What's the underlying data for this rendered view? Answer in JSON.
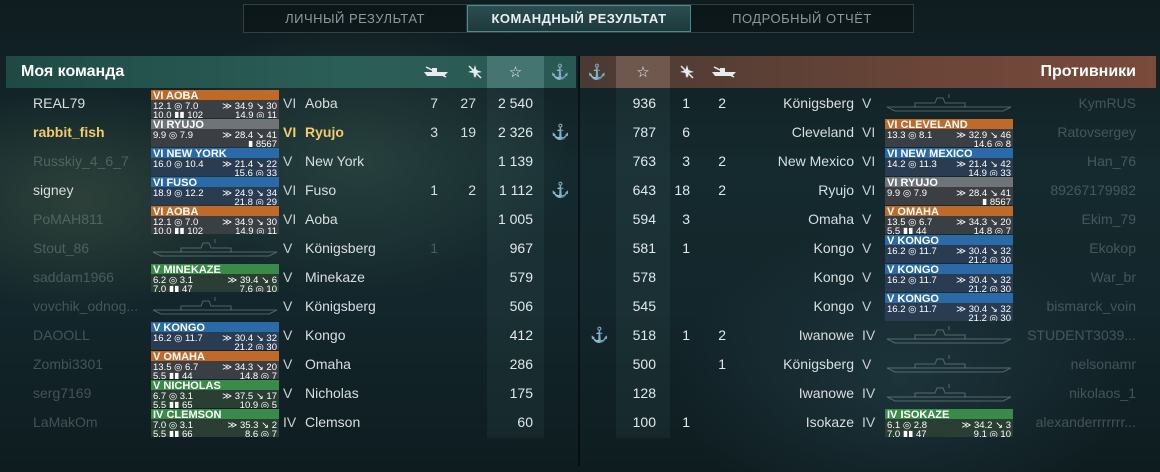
{
  "tabs": [
    {
      "label": "ЛИЧНЫЙ РЕЗУЛЬТАТ",
      "active": false
    },
    {
      "label": "КОМАНДНЫЙ РЕЗУЛЬТАТ",
      "active": true
    },
    {
      "label": "ПОДРОБНЫЙ ОТЧЁТ",
      "active": false
    }
  ],
  "my_team": {
    "title": "Моя команда",
    "columns": [
      "ship-kills-icon",
      "plane-kills-icon",
      "star-icon",
      "anchor-icon"
    ],
    "rows": [
      {
        "player": "REAL79",
        "card": {
          "title": "VI AOBA",
          "color": "orange",
          "l1a": "12.1 ◎ 7.0",
          "l1b": "≫ 34.9 ↘ 30",
          "l2a": "10.0 ▮▮ 102",
          "l2b": "14.9 ◎ 11"
        },
        "tier": "VI",
        "ship": "Aoba",
        "kills": "7",
        "planes": "27",
        "score": "2 540",
        "anchor": "",
        "dim": false,
        "me": false
      },
      {
        "player": "rabbit_fish",
        "card": {
          "title": "VI RYUJO",
          "color": "gray",
          "l1a": "9.9 ◎ 7.9",
          "l1b": "≫ 28.4 ↘ 41",
          "l2a": "",
          "l2b": "▮ 8567"
        },
        "tier": "VI",
        "ship": "Ryujo",
        "kills": "3",
        "planes": "19",
        "score": "2 326",
        "anchor": "⚓",
        "dim": false,
        "me": true
      },
      {
        "player": "Russkiy_4_6_7",
        "card": {
          "title": "VI NEW YORK",
          "color": "blue",
          "l1a": "16.0 ◎ 10.4",
          "l1b": "≫ 21.4 ↘ 22",
          "l2a": "",
          "l2b": "15.6 ◎ 33"
        },
        "tier": "V",
        "ship": "New York",
        "kills": "",
        "planes": "",
        "score": "1 139",
        "anchor": "",
        "dim": true,
        "me": false
      },
      {
        "player": "signey",
        "card": {
          "title": "VI FUSO",
          "color": "blue",
          "l1a": "18.9 ◎ 12.2",
          "l1b": "≫ 24.9 ↘ 34",
          "l2a": "",
          "l2b": "21.8 ◎ 29"
        },
        "tier": "VI",
        "ship": "Fuso",
        "kills": "1",
        "planes": "2",
        "score": "1 112",
        "anchor": "⚓",
        "dim": false,
        "me": false
      },
      {
        "player": "PoMAH811",
        "card": {
          "title": "VI AOBA",
          "color": "orange",
          "l1a": "12.1 ◎ 7.0",
          "l1b": "≫ 34.9 ↘ 30",
          "l2a": "10.0 ▮▮ 102",
          "l2b": "14.9 ◎ 11"
        },
        "tier": "VI",
        "ship": "Aoba",
        "kills": "",
        "planes": "",
        "score": "1 005",
        "anchor": "",
        "dim": true,
        "me": false
      },
      {
        "player": "Stout_86",
        "card": null,
        "tier": "V",
        "ship": "Königsberg",
        "kills": "1",
        "planes": "",
        "score": "967",
        "anchor": "",
        "dim": true,
        "me": false
      },
      {
        "player": "saddam1966",
        "card": {
          "title": "V MINEKAZE",
          "color": "green",
          "l1a": "6.2 ◎ 3.1",
          "l1b": "≫ 39.4 ↘ 6",
          "l2a": "7.0 ▮▮ 47",
          "l2b": "7.6 ◎ 10"
        },
        "tier": "V",
        "ship": "Minekaze",
        "kills": "",
        "planes": "",
        "score": "579",
        "anchor": "",
        "dim": true,
        "me": false
      },
      {
        "player": "vovchik_odnog...",
        "card": null,
        "tier": "V",
        "ship": "Königsberg",
        "kills": "",
        "planes": "",
        "score": "506",
        "anchor": "",
        "dim": true,
        "me": false
      },
      {
        "player": "DAOOLL",
        "card": {
          "title": "V KONGO",
          "color": "blue",
          "l1a": "16.2 ◎ 11.7",
          "l1b": "≫ 30.4 ↘ 32",
          "l2a": "",
          "l2b": "21.2 ◎ 30"
        },
        "tier": "V",
        "ship": "Kongo",
        "kills": "",
        "planes": "",
        "score": "412",
        "anchor": "",
        "dim": true,
        "me": false
      },
      {
        "player": "Zombi3301",
        "card": {
          "title": "V OMAHA",
          "color": "orange",
          "l1a": "13.5 ◎ 6.7",
          "l1b": "≫ 34.3 ↘ 20",
          "l2a": "5.5 ▮▮ 44",
          "l2b": "14.8 ◎ 7"
        },
        "tier": "V",
        "ship": "Omaha",
        "kills": "",
        "planes": "",
        "score": "286",
        "anchor": "",
        "dim": true,
        "me": false
      },
      {
        "player": "serg7169",
        "card": {
          "title": "V NICHOLAS",
          "color": "green",
          "l1a": "6.7 ◎ 3.1",
          "l1b": "≫ 37.5 ↘ 17",
          "l2a": "5.5 ▮▮ 65",
          "l2b": "10.9 ◎ 5"
        },
        "tier": "V",
        "ship": "Nicholas",
        "kills": "",
        "planes": "",
        "score": "175",
        "anchor": "",
        "dim": true,
        "me": false
      },
      {
        "player": "LaMakOm",
        "card": {
          "title": "IV CLEMSON",
          "color": "green",
          "l1a": "7.0 ◎ 3.1",
          "l1b": "≫ 35.3 ↘ 2",
          "l2a": "5.5 ▮▮ 66",
          "l2b": "8.6 ◎ 7"
        },
        "tier": "IV",
        "ship": "Clemson",
        "kills": "",
        "planes": "",
        "score": "60",
        "anchor": "",
        "dim": true,
        "me": false
      }
    ]
  },
  "enemy_team": {
    "title": "Противники",
    "columns": [
      "anchor-icon",
      "star-icon",
      "plane-kills-icon",
      "ship-kills-icon"
    ],
    "rows": [
      {
        "anchor": "",
        "score": "936",
        "planes": "1",
        "kills": "2",
        "ship": "Königsberg",
        "tier": "V",
        "card": null,
        "player": "KymRUS",
        "dim": true
      },
      {
        "anchor": "",
        "score": "787",
        "planes": "6",
        "kills": "",
        "ship": "Cleveland",
        "tier": "VI",
        "card": {
          "title": "VI CLEVELAND",
          "color": "orange",
          "l1a": "13.3 ◎ 8.1",
          "l1b": "≫ 32.9 ↘ 46",
          "l2a": "",
          "l2b": "14.6 ◎ 8"
        },
        "player": "Ratovsergey",
        "dim": true
      },
      {
        "anchor": "",
        "score": "763",
        "planes": "3",
        "kills": "2",
        "ship": "New Mexico",
        "tier": "VI",
        "card": {
          "title": "VI NEW MEXICO",
          "color": "blue",
          "l1a": "14.2 ◎ 11.3",
          "l1b": "≫ 21.4 ↘ 42",
          "l2a": "",
          "l2b": "14.9 ◎ 33"
        },
        "player": "Han_76",
        "dim": true
      },
      {
        "anchor": "",
        "score": "643",
        "planes": "18",
        "kills": "2",
        "ship": "Ryujo",
        "tier": "VI",
        "card": {
          "title": "VI RYUJO",
          "color": "gray",
          "l1a": "9.9 ◎ 7.9",
          "l1b": "≫ 28.4 ↘ 41",
          "l2a": "",
          "l2b": "▮ 8567"
        },
        "player": "89267179982",
        "dim": true
      },
      {
        "anchor": "",
        "score": "594",
        "planes": "3",
        "kills": "",
        "ship": "Omaha",
        "tier": "V",
        "card": {
          "title": "V OMAHA",
          "color": "orange",
          "l1a": "13.5 ◎ 6.7",
          "l1b": "≫ 34.3 ↘ 20",
          "l2a": "5.5 ▮▮ 44",
          "l2b": "14.8 ◎ 7"
        },
        "player": "Ekim_79",
        "dim": true
      },
      {
        "anchor": "",
        "score": "581",
        "planes": "1",
        "kills": "",
        "ship": "Kongo",
        "tier": "V",
        "card": {
          "title": "V KONGO",
          "color": "blue",
          "l1a": "16.2 ◎ 11.7",
          "l1b": "≫ 30.4 ↘ 32",
          "l2a": "",
          "l2b": "21.2 ◎ 30"
        },
        "player": "Ekokop",
        "dim": true
      },
      {
        "anchor": "",
        "score": "578",
        "planes": "",
        "kills": "",
        "ship": "Kongo",
        "tier": "V",
        "card": {
          "title": "V KONGO",
          "color": "blue",
          "l1a": "16.2 ◎ 11.7",
          "l1b": "≫ 30.4 ↘ 32",
          "l2a": "",
          "l2b": "21.2 ◎ 30"
        },
        "player": "War_br",
        "dim": true
      },
      {
        "anchor": "",
        "score": "545",
        "planes": "",
        "kills": "",
        "ship": "Kongo",
        "tier": "V",
        "card": {
          "title": "V KONGO",
          "color": "blue",
          "l1a": "16.2 ◎ 11.7",
          "l1b": "≫ 30.4 ↘ 32",
          "l2a": "",
          "l2b": "21.2 ◎ 30"
        },
        "player": "bismarck_voin",
        "dim": true
      },
      {
        "anchor": "⚓",
        "score": "518",
        "planes": "1",
        "kills": "2",
        "ship": "Iwanowe",
        "tier": "IV",
        "card": null,
        "player": "STUDENT3039...",
        "dim": true
      },
      {
        "anchor": "",
        "score": "500",
        "planes": "",
        "kills": "1",
        "ship": "Königsberg",
        "tier": "V",
        "card": null,
        "player": "nelsonamr",
        "dim": true
      },
      {
        "anchor": "",
        "score": "128",
        "planes": "",
        "kills": "",
        "ship": "Iwanowe",
        "tier": "IV",
        "card": null,
        "player": "nikolaos_1",
        "dim": true
      },
      {
        "anchor": "",
        "score": "100",
        "planes": "1",
        "kills": "",
        "ship": "Isokaze",
        "tier": "IV",
        "card": {
          "title": "IV ISOKAZE",
          "color": "green",
          "l1a": "6.1 ◎ 2.8",
          "l1b": "≫ 34.2 ↘ 3",
          "l2a": "7.0 ▮▮ 47",
          "l2b": "9.1 ◎ 10"
        },
        "player": "alexanderrrrrrr...",
        "dim": true
      }
    ]
  }
}
